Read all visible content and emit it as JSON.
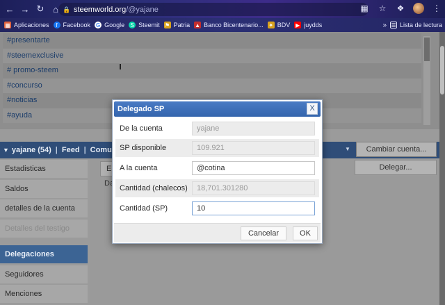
{
  "browser": {
    "url_host": "steemworld.org",
    "url_path": "/@yajane",
    "nav_icons": [
      "back-icon",
      "forward-icon",
      "reload-icon",
      "home-icon"
    ],
    "toolbar_icons": [
      "translate-icon",
      "bookmark-star-icon",
      "extensions-icon",
      "profile-avatar"
    ],
    "bookmarks": [
      {
        "label": "Aplicaciones",
        "icon": "apps-grid-icon",
        "color": "#e0623d"
      },
      {
        "label": "Facebook",
        "icon": "facebook-icon",
        "color": "#1877f2"
      },
      {
        "label": "Google",
        "icon": "google-icon",
        "color": "#ffffff"
      },
      {
        "label": "Steemit",
        "icon": "steemit-icon",
        "color": "#06d6a9"
      },
      {
        "label": "Patria",
        "icon": "patria-icon",
        "color": "#d9a21d"
      },
      {
        "label": "Banco Bicentenario...",
        "icon": "bank-icon",
        "color": "#c42d2d"
      },
      {
        "label": "BDV",
        "icon": "bdv-icon",
        "color": "#d9a21d"
      },
      {
        "label": "juydds",
        "icon": "youtube-icon",
        "color": "#ff0000"
      }
    ],
    "bookmarks_more": "»",
    "reading_list": "Lista de lectura"
  },
  "tags": [
    "#presentarte",
    "#steemexclusive",
    "# promo-steem",
    "#concurso",
    "#noticias",
    "#ayuda"
  ],
  "userbar": {
    "username": "yajane (54)",
    "separator": "|",
    "feed": "Feed",
    "community": "Comun",
    "change_account": "Cambiar cuenta..."
  },
  "sidebar": {
    "items": [
      {
        "label": "Estadisticas",
        "state": "normal"
      },
      {
        "label": "Saldos",
        "state": "normal"
      },
      {
        "label": "detalles de la cuenta",
        "state": "normal"
      },
      {
        "label": "Detalles del testigo",
        "state": "disabled"
      },
      {
        "label": "Delegaciones",
        "state": "active"
      },
      {
        "label": "Seguidores",
        "state": "normal"
      },
      {
        "label": "Menciones",
        "state": "normal"
      }
    ]
  },
  "content": {
    "tab_partial": "E",
    "line_partial": "Da",
    "delegate_button": "Delegar..."
  },
  "modal": {
    "title": "Delegado SP",
    "close": "X",
    "fields": [
      {
        "label": "De la cuenta",
        "value": "yajane",
        "state": "readonly"
      },
      {
        "label": "SP disponible",
        "value": "109.921",
        "state": "readonly"
      },
      {
        "label": "A la cuenta",
        "value": "@cotina",
        "state": "editable"
      },
      {
        "label": "Cantidad (chalecos)",
        "value": "18,701.301280",
        "state": "readonly"
      },
      {
        "label": "Cantidad (SP)",
        "value": "10",
        "state": "focused"
      }
    ],
    "cancel": "Cancelar",
    "ok": "OK"
  },
  "colors": {
    "modal_header": "#3a6db5",
    "userbar": "#2f4d78",
    "active_item": "#3c6494",
    "tag_text": "#1d3e6b"
  }
}
